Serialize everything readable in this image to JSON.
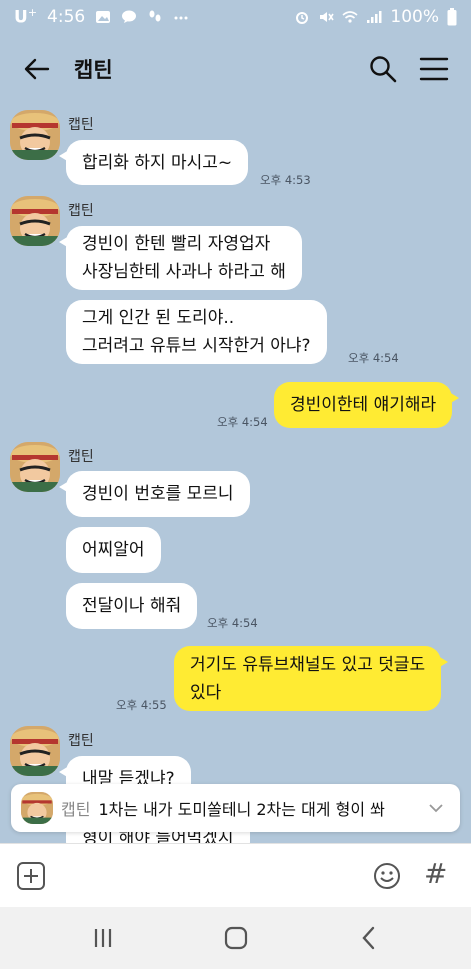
{
  "status": {
    "carrier": "U",
    "carrier_sup": "+",
    "time": "4:56",
    "battery": "100%"
  },
  "header": {
    "title": "캡틴"
  },
  "messages": [
    {
      "sender": "캡틴",
      "text": "합리화 하지 마시고~",
      "time": "오후 4:53"
    },
    {
      "sender": "캡틴",
      "text": "경빈이 한텐 빨리 자영업자\n사장님한테 사과나 하라고 해"
    },
    {
      "text": "그게 인간 된 도리야..\n그러려고 유튜브 시작한거 아냐?",
      "time": "오후 4:54"
    },
    {
      "me": true,
      "text": "경빈이한테 얘기해라",
      "time": "오후 4:54"
    },
    {
      "sender": "캡틴",
      "text": "경빈이 번호를 모르니"
    },
    {
      "text": "어찌알어"
    },
    {
      "text": "전달이나 해줘",
      "time": "오후 4:54"
    },
    {
      "me": true,
      "text": "거기도 유튜브채널도 있고 덧글도\n있다",
      "time": "오후 4:55"
    },
    {
      "sender": "캡틴",
      "text": "내말 듣겠냐?"
    },
    {
      "text": "형이 해야 들어먹겠지"
    }
  ],
  "notice": {
    "name": "캡틴",
    "text": "1차는 내가 도미쏠테니 2차는 대게 형이 쏴"
  },
  "icons": {
    "back": "arrow-left-icon",
    "search": "search-icon",
    "menu": "hamburger-menu-icon",
    "plus": "plus-square-icon",
    "emoji": "smiley-icon",
    "hash": "#"
  },
  "colors": {
    "background": "#b2c7da",
    "my_bubble": "#ffeb33",
    "their_bubble": "#ffffff"
  }
}
